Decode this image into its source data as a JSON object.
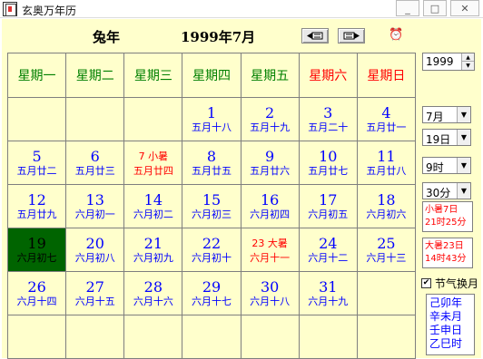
{
  "window": {
    "title": "玄奥万年历",
    "min": "_",
    "max": "□",
    "close": "✕"
  },
  "header": {
    "zodiac_year": "兔年",
    "year_month": "1999年7月",
    "prev_icon": "pointing-left-icon",
    "next_icon": "pointing-right-icon",
    "alarm_icon": "alarm-clock-icon"
  },
  "weekdays": [
    "星期一",
    "星期二",
    "星期三",
    "星期四",
    "星期五",
    "星期六",
    "星期日"
  ],
  "weeks": [
    [
      {},
      {},
      {},
      {
        "d": "1",
        "l": "五月十八"
      },
      {
        "d": "2",
        "l": "五月十九"
      },
      {
        "d": "3",
        "l": "五月二十"
      },
      {
        "d": "4",
        "l": "五月廿一"
      }
    ],
    [
      {
        "d": "5",
        "l": "五月廿二"
      },
      {
        "d": "6",
        "l": "五月廿三"
      },
      {
        "d": "7 小暑",
        "l": "五月廿四",
        "red": true
      },
      {
        "d": "8",
        "l": "五月廿五"
      },
      {
        "d": "9",
        "l": "五月廿六"
      },
      {
        "d": "10",
        "l": "五月廿七"
      },
      {
        "d": "11",
        "l": "五月廿八"
      }
    ],
    [
      {
        "d": "12",
        "l": "五月廿九"
      },
      {
        "d": "13",
        "l": "六月初一"
      },
      {
        "d": "14",
        "l": "六月初二"
      },
      {
        "d": "15",
        "l": "六月初三"
      },
      {
        "d": "16",
        "l": "六月初四"
      },
      {
        "d": "17",
        "l": "六月初五"
      },
      {
        "d": "18",
        "l": "六月初六"
      }
    ],
    [
      {
        "d": "19",
        "l": "六月初七",
        "today": true
      },
      {
        "d": "20",
        "l": "六月初八"
      },
      {
        "d": "21",
        "l": "六月初九"
      },
      {
        "d": "22",
        "l": "六月初十"
      },
      {
        "d": "23 大暑",
        "l": "六月十一",
        "red": true
      },
      {
        "d": "24",
        "l": "六月十二"
      },
      {
        "d": "25",
        "l": "六月十三"
      }
    ],
    [
      {
        "d": "26",
        "l": "六月十四"
      },
      {
        "d": "27",
        "l": "六月十五"
      },
      {
        "d": "28",
        "l": "六月十六"
      },
      {
        "d": "29",
        "l": "六月十七"
      },
      {
        "d": "30",
        "l": "六月十八"
      },
      {
        "d": "31",
        "l": "六月十九"
      },
      {}
    ],
    [
      {},
      {},
      {},
      {},
      {},
      {},
      {}
    ]
  ],
  "controls": {
    "year": "1999",
    "month": "7月",
    "day": "19日",
    "hour": "9时",
    "minute": "30分"
  },
  "terms": {
    "term1_name": "小暑7日",
    "term1_time": "21时25分",
    "term2_name": "大暑23日",
    "term2_time": "14时43分"
  },
  "solar_month": {
    "label": "节气换月",
    "checked": "✔"
  },
  "bazi": [
    "己卯年",
    "辛未月",
    "壬申日",
    "乙巳时"
  ],
  "colors": {
    "background": "#ffffcc",
    "weekday": "#008000",
    "weekend": "#ff0000",
    "date": "#0000ff",
    "today": "#006400"
  }
}
